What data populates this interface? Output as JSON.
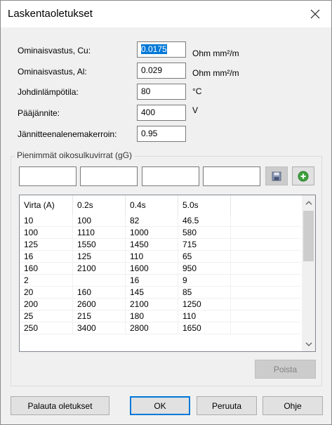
{
  "window": {
    "title": "Laskentaoletukset"
  },
  "fields": [
    {
      "name": "resistivity-cu",
      "label": "Ominaisvastus, Cu:",
      "value": "0.0175",
      "unit": "Ohm mm²/m"
    },
    {
      "name": "resistivity-al",
      "label": "Ominaisvastus, Al:",
      "value": "0.029",
      "unit": "Ohm mm²/m"
    },
    {
      "name": "conductor-temp",
      "label": "Johdinlämpötila:",
      "value": "80",
      "unit": "°C"
    },
    {
      "name": "main-voltage",
      "label": "Pääjännite:",
      "value": "400",
      "unit": "V"
    },
    {
      "name": "voltage-drop-coeff",
      "label": "Jännitteenalenemakerroin:",
      "value": "0.95",
      "unit": ""
    }
  ],
  "group": {
    "label": "Pienimmät oikosulkuvirrat (gG)"
  },
  "entry_values": [
    "",
    "",
    "",
    ""
  ],
  "table": {
    "columns": [
      "Virta (A)",
      "0.2s",
      "0.4s",
      "5.0s"
    ],
    "rows": [
      [
        "10",
        "100",
        "82",
        "46.5"
      ],
      [
        "100",
        "1110",
        "1000",
        "580"
      ],
      [
        "125",
        "1550",
        "1450",
        "715"
      ],
      [
        "16",
        "125",
        "110",
        "65"
      ],
      [
        "160",
        "2100",
        "1600",
        "950"
      ],
      [
        "2",
        "",
        "16",
        "9"
      ],
      [
        "20",
        "160",
        "145",
        "85"
      ],
      [
        "200",
        "2600",
        "2100",
        "1250"
      ],
      [
        "25",
        "215",
        "180",
        "110"
      ],
      [
        "250",
        "3400",
        "2800",
        "1650"
      ]
    ]
  },
  "buttons": {
    "delete": "Poista",
    "restore_defaults": "Palauta oletukset",
    "ok": "OK",
    "cancel": "Peruuta",
    "help": "Ohje"
  },
  "icons": {
    "close": "close-icon",
    "save": "save-disk-icon",
    "add": "add-circle-icon",
    "scroll_up": "chevron-up-icon",
    "scroll_down": "chevron-down-icon"
  },
  "colors": {
    "selection": "#0078d7",
    "add_icon": "#3fa33f",
    "dialog_bg": "#f0f0f0"
  }
}
